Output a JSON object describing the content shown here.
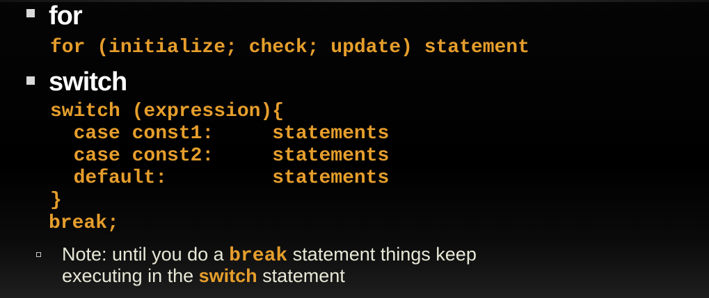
{
  "slide": {
    "for_section": {
      "heading": "for",
      "syntax": "for (initialize; check; update) statement"
    },
    "switch_section": {
      "heading": "switch",
      "code_lines": [
        "switch (expression){",
        "  case const1:     statements",
        "  case const2:     statements",
        "  default:         statements",
        "}",
        "break;"
      ]
    },
    "note": {
      "prefix": "Note: until you do a ",
      "keyword": "break",
      "middle": " statement things keep",
      "line2_prefix": "executing in the ",
      "switch_word": "switch",
      "line2_suffix": " statement"
    },
    "colors": {
      "background": "#000000",
      "heading": "#ffffff",
      "code": "#e69e2c",
      "note_text": "#e8e8d8"
    }
  }
}
